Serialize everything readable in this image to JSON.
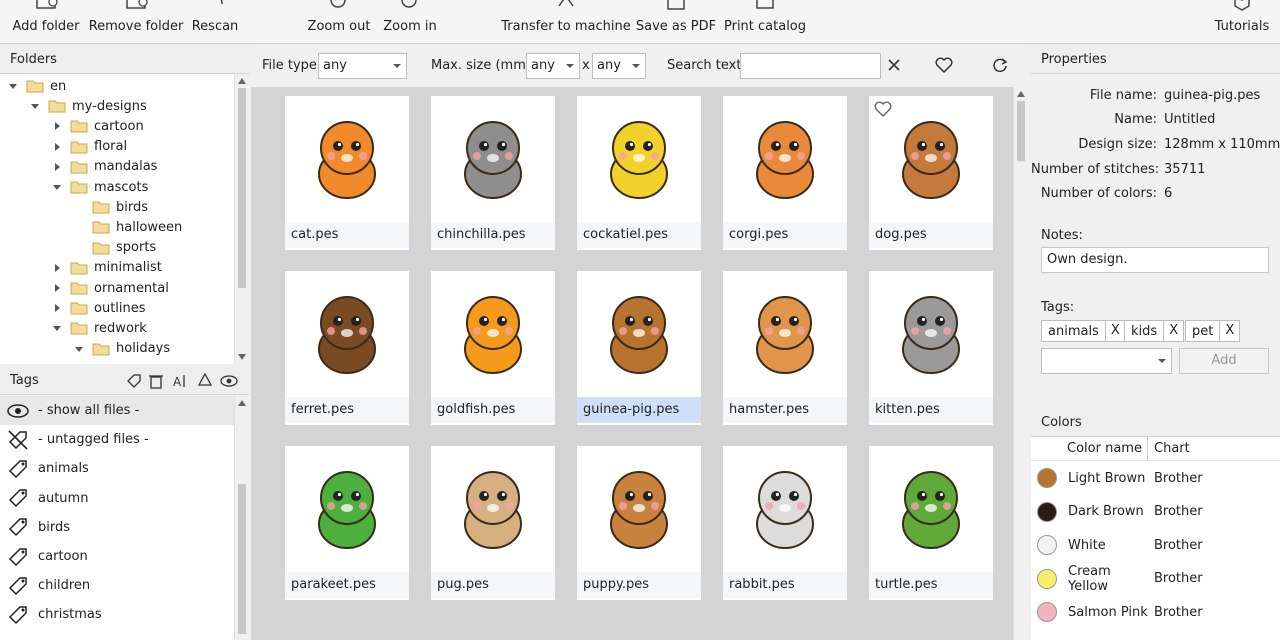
{
  "toolbar": {
    "add_folder": "Add folder",
    "remove_folder": "Remove folder",
    "rescan": "Rescan",
    "zoom_out": "Zoom out",
    "zoom_in": "Zoom in",
    "transfer": "Transfer to machine",
    "save_pdf": "Save as PDF",
    "print_catalog": "Print catalog",
    "tutorials": "Tutorials"
  },
  "folders": {
    "header": "Folders",
    "items": [
      {
        "label": "en",
        "depth": 0,
        "expanded": true,
        "has_children": true
      },
      {
        "label": "my-designs",
        "depth": 1,
        "expanded": true,
        "has_children": true
      },
      {
        "label": "cartoon",
        "depth": 2,
        "expanded": false,
        "has_children": true
      },
      {
        "label": "floral",
        "depth": 2,
        "expanded": false,
        "has_children": true
      },
      {
        "label": "mandalas",
        "depth": 2,
        "expanded": false,
        "has_children": true
      },
      {
        "label": "mascots",
        "depth": 2,
        "expanded": true,
        "has_children": true
      },
      {
        "label": "birds",
        "depth": 3,
        "expanded": false,
        "has_children": false
      },
      {
        "label": "halloween",
        "depth": 3,
        "expanded": false,
        "has_children": false
      },
      {
        "label": "sports",
        "depth": 3,
        "expanded": false,
        "has_children": false
      },
      {
        "label": "minimalist",
        "depth": 2,
        "expanded": false,
        "has_children": true
      },
      {
        "label": "ornamental",
        "depth": 2,
        "expanded": false,
        "has_children": true
      },
      {
        "label": "outlines",
        "depth": 2,
        "expanded": false,
        "has_children": true
      },
      {
        "label": "redwork",
        "depth": 2,
        "expanded": true,
        "has_children": true
      },
      {
        "label": "holidays",
        "depth": 3,
        "expanded": true,
        "has_children": true
      }
    ]
  },
  "tags": {
    "header": "Tags",
    "items": [
      {
        "label": "- show all files -",
        "icon": "eye-icon"
      },
      {
        "label": "- untagged files -",
        "icon": "untagged-icon"
      },
      {
        "label": "animals",
        "icon": "tag-icon"
      },
      {
        "label": "autumn",
        "icon": "tag-icon"
      },
      {
        "label": "birds",
        "icon": "tag-icon"
      },
      {
        "label": "cartoon",
        "icon": "tag-icon"
      },
      {
        "label": "children",
        "icon": "tag-icon"
      },
      {
        "label": "christmas",
        "icon": "tag-icon"
      }
    ]
  },
  "filters": {
    "file_type_label": "File type:",
    "file_type_value": "any",
    "max_size_label": "Max. size (mm):",
    "max_w_value": "any",
    "x_label": "x",
    "max_h_value": "any",
    "search_label": "Search text:",
    "search_value": ""
  },
  "files": [
    {
      "name": "cat.pes",
      "color": "#f08a2a",
      "selected": false
    },
    {
      "name": "chinchilla.pes",
      "color": "#8e8e8e",
      "selected": false
    },
    {
      "name": "cockatiel.pes",
      "color": "#f2d22a",
      "selected": false
    },
    {
      "name": "corgi.pes",
      "color": "#e98a3a",
      "selected": false
    },
    {
      "name": "dog.pes",
      "color": "#c47a3a",
      "selected": false
    },
    {
      "name": "ferret.pes",
      "color": "#7a4a22",
      "selected": false
    },
    {
      "name": "goldfish.pes",
      "color": "#f59a1a",
      "selected": false
    },
    {
      "name": "guinea-pig.pes",
      "color": "#b8742e",
      "selected": true
    },
    {
      "name": "hamster.pes",
      "color": "#e0954a",
      "selected": false
    },
    {
      "name": "kitten.pes",
      "color": "#9a9a9a",
      "selected": false
    },
    {
      "name": "parakeet.pes",
      "color": "#4caf3e",
      "selected": false
    },
    {
      "name": "pug.pes",
      "color": "#d6b080",
      "selected": false
    },
    {
      "name": "puppy.pes",
      "color": "#c9823e",
      "selected": false
    },
    {
      "name": "rabbit.pes",
      "color": "#dcdcdc",
      "selected": false
    },
    {
      "name": "turtle.pes",
      "color": "#5fa83a",
      "selected": false
    }
  ],
  "properties": {
    "header": "Properties",
    "file_name_label": "File name:",
    "file_name_value": "guinea-pig.pes",
    "name_label": "Name:",
    "name_value": "Untitled",
    "design_size_label": "Design size:",
    "design_size_value": "128mm x 110mm",
    "stitches_label": "Number of stitches:",
    "stitches_value": "35711",
    "colors_label": "Number of colors:",
    "colors_value": "6",
    "notes_label": "Notes:",
    "notes_value": "Own design.",
    "tags_label": "Tags:",
    "tag_chips": [
      "animals",
      "kids",
      "pet"
    ],
    "chip_remove": "X",
    "add_button": "Add"
  },
  "colors": {
    "header": "Colors",
    "col_name": "Color name",
    "col_chart": "Chart",
    "rows": [
      {
        "name": "Light Brown",
        "chart": "Brother",
        "hex": "#b5752f"
      },
      {
        "name": "Dark Brown",
        "chart": "Brother",
        "hex": "#2e1a0e"
      },
      {
        "name": "White",
        "chart": "Brother",
        "hex": "#f2f2f2"
      },
      {
        "name": "Cream Yellow",
        "chart": "Brother",
        "hex": "#f7ee6a"
      },
      {
        "name": "Salmon Pink",
        "chart": "Brother",
        "hex": "#f4b4be"
      }
    ]
  }
}
